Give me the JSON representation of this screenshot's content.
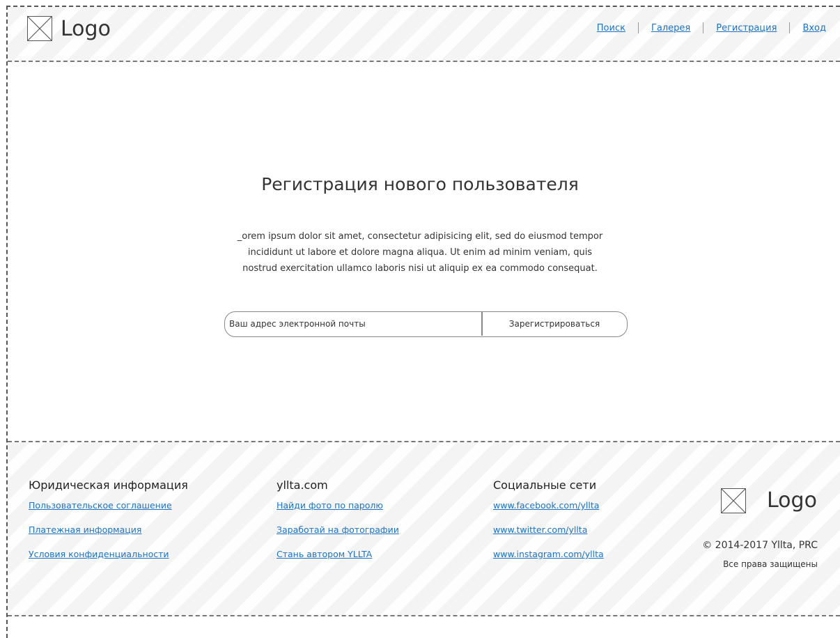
{
  "header": {
    "logo_text": "Logo",
    "nav": [
      {
        "label": "Поиск"
      },
      {
        "label": "Галерея"
      },
      {
        "label": "Регистрация"
      },
      {
        "label": "Вход"
      }
    ]
  },
  "main": {
    "title": "Регистрация нового пользователя",
    "lorem_lines": [
      "_orem ipsum dolor sit amet, consectetur adipisicing elit, sed do eiusmod tempor",
      "incididunt ut labore et dolore magna aliqua. Ut enim ad minim veniam, quis",
      "nostrud exercitation ullamco laboris nisi ut aliquip ex ea commodo consequat."
    ],
    "email_placeholder": "Ваш адрес электронной почты",
    "register_button": "Зарегистрироваться"
  },
  "footer": {
    "columns": [
      {
        "heading": "Юридическая информация",
        "links": [
          "Пользовательское соглашение",
          "Платежная информация",
          "Условия конфиденциальности"
        ]
      },
      {
        "heading": "yllta.com",
        "links": [
          "Найди фото по паролю",
          "Заработай на фотографии",
          "Стань автором YLLTA"
        ]
      },
      {
        "heading": "Социальные сети",
        "links": [
          "www.facebook.com/yllta",
          "www.twitter.com/yllta",
          "www.instagram.com/yllta"
        ]
      }
    ],
    "logo_text": "Logo",
    "copyright": "© 2014-2017 Yllta, PRC",
    "rights": "Все права защищены"
  },
  "colors": {
    "link": "#1a73c9",
    "hatch_bg": "#f4f4f4",
    "border": "#555555"
  },
  "icons": {
    "logo_placeholder": "image-placeholder-icon"
  }
}
